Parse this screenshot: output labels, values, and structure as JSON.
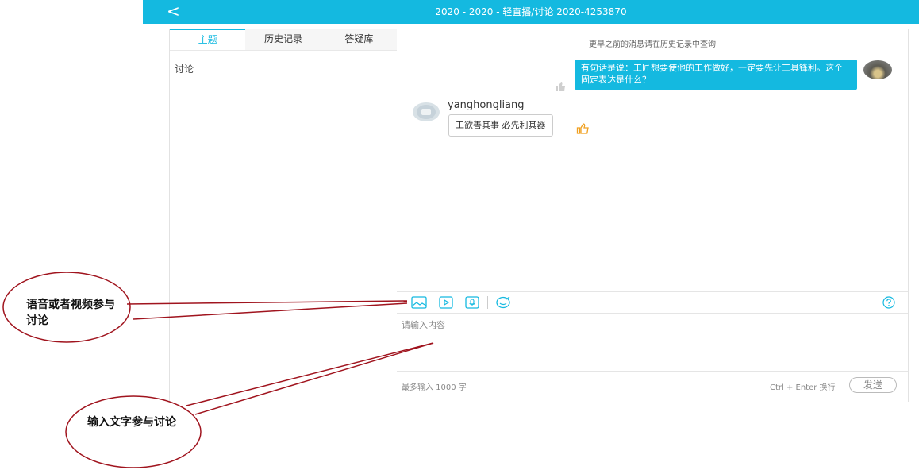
{
  "header": {
    "back_glyph": "<",
    "title": "2020 - 2020 - 轻直播/讨论 2020-4253870"
  },
  "sidebar": {
    "tabs": [
      {
        "label": "主题"
      },
      {
        "label": "历史记录"
      },
      {
        "label": "答疑库"
      }
    ],
    "topic": "讨论"
  },
  "chat": {
    "history_hint": "更早之前的消息请在历史记录中查询",
    "messages": [
      {
        "side": "right",
        "text": "有句话是说：工匠想要使他的工作做好，一定要先让工具锋利。这个固定表达是什么？"
      },
      {
        "side": "left",
        "username": "yanghongliang",
        "text": "工欲善其事 必先利其器"
      }
    ]
  },
  "composer": {
    "placeholder": "请输入内容",
    "max_length_text": "最多输入 1000 字",
    "shortcut_text": "Ctrl + Enter 换行",
    "send_label": "发送",
    "icons": [
      "image-icon",
      "video-icon",
      "microphone-icon",
      "emoji-icon",
      "help-icon"
    ]
  },
  "annotations": {
    "voice_video": "语音或者视频参与讨论",
    "text_input": "输入文字参与讨论"
  },
  "colors": {
    "accent": "#14b9e0",
    "annotation": "#a0141e",
    "like_orange": "#f0a020"
  }
}
